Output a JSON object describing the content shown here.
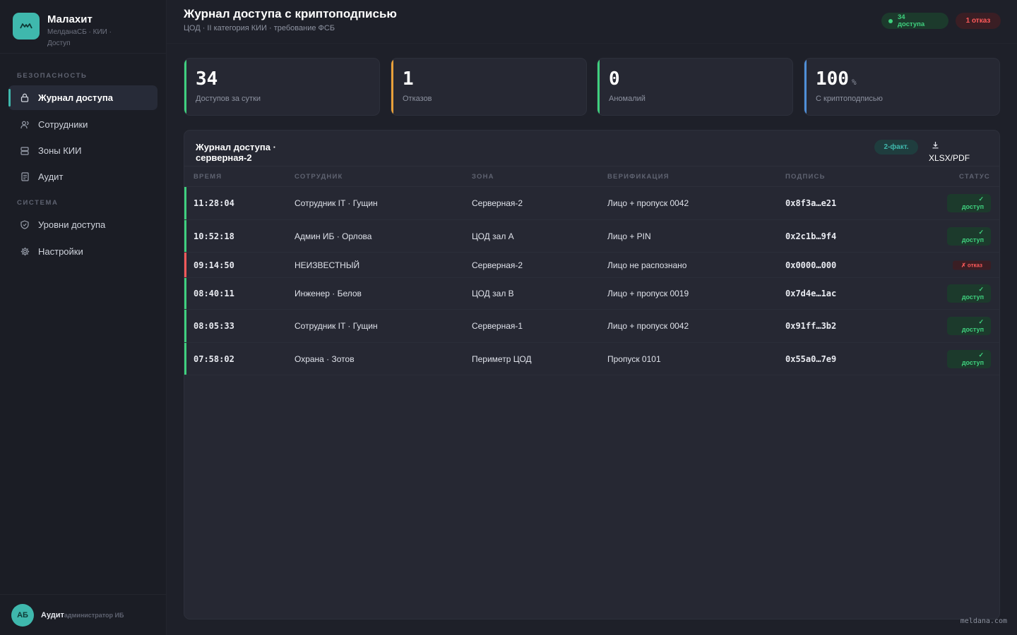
{
  "sidebar": {
    "brand_name": "Малахит",
    "brand_sub": "МелданаСБ · КИИ · Доступ",
    "section_security": "Безопасность",
    "section_system": "Система",
    "items": [
      {
        "label": "Журнал доступа",
        "icon": "lock-icon",
        "active": true
      },
      {
        "label": "Сотрудники",
        "icon": "users-icon"
      },
      {
        "label": "Зоны КИИ",
        "icon": "server-icon"
      },
      {
        "label": "Аудит",
        "icon": "document-icon"
      },
      {
        "label": "Уровни доступа",
        "icon": "shield-icon"
      },
      {
        "label": "Настройки",
        "icon": "gear-icon"
      }
    ],
    "user": {
      "initials": "АБ",
      "name": "Аудит",
      "role": "администратор ИБ"
    }
  },
  "header": {
    "title": "Журнал доступа с криптоподписью",
    "subtitle": "ЦОД · II категория КИИ · требование ФСБ",
    "badge_ok_count": "34",
    "badge_ok_label": "доступа",
    "badge_bad": "1 отказ"
  },
  "stats": [
    {
      "value": "34",
      "unit": "",
      "label": "Доступов за сутки",
      "color": "#3fd07e"
    },
    {
      "value": "1",
      "unit": "",
      "label": "Отказов",
      "color": "#e8a03a"
    },
    {
      "value": "0",
      "unit": "",
      "label": "Аномалий",
      "color": "#3fd07e"
    },
    {
      "value": "100",
      "unit": "%",
      "label": "С криптоподписью",
      "color": "#4f8fd8"
    }
  ],
  "table": {
    "title": "Журнал доступа · серверная-2",
    "factor_badge": "2-факт.",
    "export_label": "XLSX/PDF",
    "columns": [
      "Время",
      "Сотрудник",
      "Зона",
      "Верификация",
      "Подпись",
      "Статус"
    ],
    "rows": [
      {
        "time": "11:28:04",
        "employee": "Сотрудник IT · Гущин",
        "zone": "Серверная-2",
        "verification": "Лицо + пропуск 0042",
        "signature": "0x8f3a…e21",
        "status": "доступ",
        "ok": true
      },
      {
        "time": "10:52:18",
        "employee": "Админ ИБ · Орлова",
        "zone": "ЦОД зал А",
        "verification": "Лицо + PIN",
        "signature": "0x2c1b…9f4",
        "status": "доступ",
        "ok": true
      },
      {
        "time": "09:14:50",
        "employee": "НЕИЗВЕСТНЫЙ",
        "zone": "Серверная-2",
        "verification": "Лицо не распознано",
        "signature": "0x0000…000",
        "status": "✗ отказ",
        "ok": false
      },
      {
        "time": "08:40:11",
        "employee": "Инженер · Белов",
        "zone": "ЦОД зал В",
        "verification": "Лицо + пропуск 0019",
        "signature": "0x7d4e…1ac",
        "status": "доступ",
        "ok": true
      },
      {
        "time": "08:05:33",
        "employee": "Сотрудник IT · Гущин",
        "zone": "Серверная-1",
        "verification": "Лицо + пропуск 0042",
        "signature": "0x91ff…3b2",
        "status": "доступ",
        "ok": true
      },
      {
        "time": "07:58:02",
        "employee": "Охрана · Зотов",
        "zone": "Периметр ЦОД",
        "verification": "Пропуск 0101",
        "signature": "0x55a0…7e9",
        "status": "доступ",
        "ok": true
      }
    ]
  },
  "watermark": "meldana.com",
  "colors": {
    "accent": "#3fb8ad",
    "ok": "#3fd07e",
    "bad": "#ff5a5a",
    "warn": "#e8a03a",
    "info": "#4f8fd8"
  }
}
